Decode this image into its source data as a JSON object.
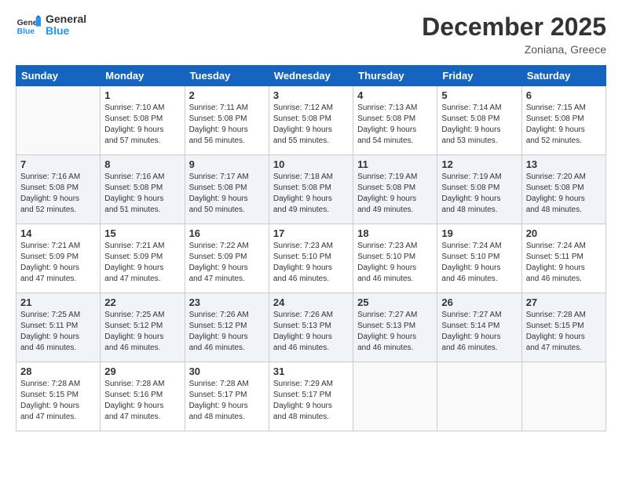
{
  "header": {
    "logo_general": "General",
    "logo_blue": "Blue",
    "month": "December 2025",
    "location": "Zoniana, Greece"
  },
  "weekdays": [
    "Sunday",
    "Monday",
    "Tuesday",
    "Wednesday",
    "Thursday",
    "Friday",
    "Saturday"
  ],
  "weeks": [
    [
      {
        "day": "",
        "info": ""
      },
      {
        "day": "1",
        "info": "Sunrise: 7:10 AM\nSunset: 5:08 PM\nDaylight: 9 hours\nand 57 minutes."
      },
      {
        "day": "2",
        "info": "Sunrise: 7:11 AM\nSunset: 5:08 PM\nDaylight: 9 hours\nand 56 minutes."
      },
      {
        "day": "3",
        "info": "Sunrise: 7:12 AM\nSunset: 5:08 PM\nDaylight: 9 hours\nand 55 minutes."
      },
      {
        "day": "4",
        "info": "Sunrise: 7:13 AM\nSunset: 5:08 PM\nDaylight: 9 hours\nand 54 minutes."
      },
      {
        "day": "5",
        "info": "Sunrise: 7:14 AM\nSunset: 5:08 PM\nDaylight: 9 hours\nand 53 minutes."
      },
      {
        "day": "6",
        "info": "Sunrise: 7:15 AM\nSunset: 5:08 PM\nDaylight: 9 hours\nand 52 minutes."
      }
    ],
    [
      {
        "day": "7",
        "info": "Sunrise: 7:16 AM\nSunset: 5:08 PM\nDaylight: 9 hours\nand 52 minutes."
      },
      {
        "day": "8",
        "info": "Sunrise: 7:16 AM\nSunset: 5:08 PM\nDaylight: 9 hours\nand 51 minutes."
      },
      {
        "day": "9",
        "info": "Sunrise: 7:17 AM\nSunset: 5:08 PM\nDaylight: 9 hours\nand 50 minutes."
      },
      {
        "day": "10",
        "info": "Sunrise: 7:18 AM\nSunset: 5:08 PM\nDaylight: 9 hours\nand 49 minutes."
      },
      {
        "day": "11",
        "info": "Sunrise: 7:19 AM\nSunset: 5:08 PM\nDaylight: 9 hours\nand 49 minutes."
      },
      {
        "day": "12",
        "info": "Sunrise: 7:19 AM\nSunset: 5:08 PM\nDaylight: 9 hours\nand 48 minutes."
      },
      {
        "day": "13",
        "info": "Sunrise: 7:20 AM\nSunset: 5:08 PM\nDaylight: 9 hours\nand 48 minutes."
      }
    ],
    [
      {
        "day": "14",
        "info": "Sunrise: 7:21 AM\nSunset: 5:09 PM\nDaylight: 9 hours\nand 47 minutes."
      },
      {
        "day": "15",
        "info": "Sunrise: 7:21 AM\nSunset: 5:09 PM\nDaylight: 9 hours\nand 47 minutes."
      },
      {
        "day": "16",
        "info": "Sunrise: 7:22 AM\nSunset: 5:09 PM\nDaylight: 9 hours\nand 47 minutes."
      },
      {
        "day": "17",
        "info": "Sunrise: 7:23 AM\nSunset: 5:10 PM\nDaylight: 9 hours\nand 46 minutes."
      },
      {
        "day": "18",
        "info": "Sunrise: 7:23 AM\nSunset: 5:10 PM\nDaylight: 9 hours\nand 46 minutes."
      },
      {
        "day": "19",
        "info": "Sunrise: 7:24 AM\nSunset: 5:10 PM\nDaylight: 9 hours\nand 46 minutes."
      },
      {
        "day": "20",
        "info": "Sunrise: 7:24 AM\nSunset: 5:11 PM\nDaylight: 9 hours\nand 46 minutes."
      }
    ],
    [
      {
        "day": "21",
        "info": "Sunrise: 7:25 AM\nSunset: 5:11 PM\nDaylight: 9 hours\nand 46 minutes."
      },
      {
        "day": "22",
        "info": "Sunrise: 7:25 AM\nSunset: 5:12 PM\nDaylight: 9 hours\nand 46 minutes."
      },
      {
        "day": "23",
        "info": "Sunrise: 7:26 AM\nSunset: 5:12 PM\nDaylight: 9 hours\nand 46 minutes."
      },
      {
        "day": "24",
        "info": "Sunrise: 7:26 AM\nSunset: 5:13 PM\nDaylight: 9 hours\nand 46 minutes."
      },
      {
        "day": "25",
        "info": "Sunrise: 7:27 AM\nSunset: 5:13 PM\nDaylight: 9 hours\nand 46 minutes."
      },
      {
        "day": "26",
        "info": "Sunrise: 7:27 AM\nSunset: 5:14 PM\nDaylight: 9 hours\nand 46 minutes."
      },
      {
        "day": "27",
        "info": "Sunrise: 7:28 AM\nSunset: 5:15 PM\nDaylight: 9 hours\nand 47 minutes."
      }
    ],
    [
      {
        "day": "28",
        "info": "Sunrise: 7:28 AM\nSunset: 5:15 PM\nDaylight: 9 hours\nand 47 minutes."
      },
      {
        "day": "29",
        "info": "Sunrise: 7:28 AM\nSunset: 5:16 PM\nDaylight: 9 hours\nand 47 minutes."
      },
      {
        "day": "30",
        "info": "Sunrise: 7:28 AM\nSunset: 5:17 PM\nDaylight: 9 hours\nand 48 minutes."
      },
      {
        "day": "31",
        "info": "Sunrise: 7:29 AM\nSunset: 5:17 PM\nDaylight: 9 hours\nand 48 minutes."
      },
      {
        "day": "",
        "info": ""
      },
      {
        "day": "",
        "info": ""
      },
      {
        "day": "",
        "info": ""
      }
    ]
  ]
}
